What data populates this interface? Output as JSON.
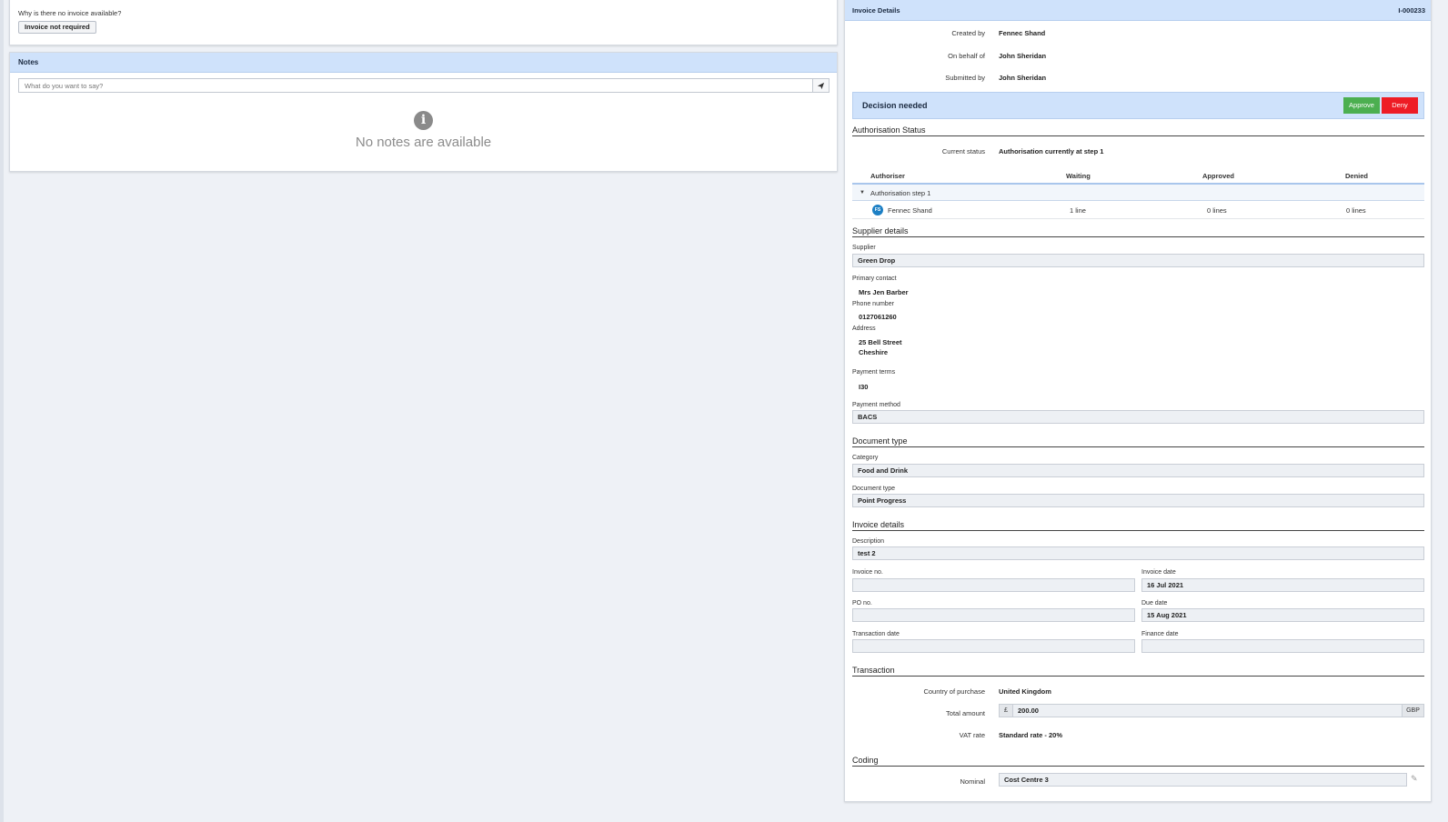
{
  "left": {
    "no_invoice_question": "Why is there no invoice available?",
    "invoice_not_required_label": "Invoice not required",
    "notes": {
      "title": "Notes",
      "input_placeholder": "What do you want to say?",
      "empty_message": "No notes are available",
      "send_icon": "send-icon",
      "info_icon": "info-icon"
    }
  },
  "panel": {
    "title": "Invoice Details",
    "reference": "I-000233",
    "created_by_label": "Created by",
    "created_by": "Fennec Shand",
    "on_behalf_of_label": "On behalf of",
    "on_behalf_of": "John Sheridan",
    "submitted_by_label": "Submitted by",
    "submitted_by": "John Sheridan",
    "decision": {
      "text": "Decision needed",
      "approve_label": "Approve",
      "deny_label": "Deny",
      "approve_color": "#4caf50",
      "deny_color": "#ee1c25"
    },
    "authorisation": {
      "title": "Authorisation Status",
      "current_status_label": "Current status",
      "current_status": "Authorisation currently at step 1",
      "columns": [
        "Authoriser",
        "Waiting",
        "Approved",
        "Denied"
      ],
      "step_label": "Authorisation step 1",
      "rows": [
        {
          "initials": "FS",
          "name": "Fennec Shand",
          "waiting": "1 line",
          "approved": "0 lines",
          "denied": "0 lines"
        }
      ]
    },
    "supplier": {
      "title": "Supplier details",
      "supplier_label": "Supplier",
      "supplier": "Green Drop",
      "primary_contact_label": "Primary contact",
      "primary_contact": "Mrs Jen Barber",
      "phone_label": "Phone number",
      "phone": "0127061260",
      "address_label": "Address",
      "address_line1": "25 Bell Street",
      "address_line2": "Cheshire",
      "payment_terms_label": "Payment terms",
      "payment_terms": "I30",
      "payment_method_label": "Payment method",
      "payment_method": "BACS"
    },
    "document": {
      "title": "Document type",
      "category_label": "Category",
      "category": "Food and Drink",
      "doc_type_label": "Document type",
      "doc_type": "Point Progress"
    },
    "invoice": {
      "title": "Invoice details",
      "description_label": "Description",
      "description": "test 2",
      "invoice_no_label": "Invoice no.",
      "invoice_no": "",
      "invoice_date_label": "Invoice date",
      "invoice_date": "16 Jul 2021",
      "po_no_label": "PO no.",
      "po_no": "",
      "due_date_label": "Due date",
      "due_date": "15 Aug 2021",
      "transaction_date_label": "Transaction date",
      "transaction_date": "",
      "finance_date_label": "Finance date",
      "finance_date": ""
    },
    "transaction": {
      "title": "Transaction",
      "country_label": "Country of purchase",
      "country": "United Kingdom",
      "total_label": "Total amount",
      "currency_symbol": "£",
      "total": "200.00",
      "currency_code": "GBP",
      "vat_label": "VAT rate",
      "vat": "Standard rate - 20%"
    },
    "coding": {
      "title": "Coding",
      "nominal_label": "Nominal",
      "nominal": "Cost Centre 3",
      "edit_icon": "pencil-icon"
    }
  }
}
